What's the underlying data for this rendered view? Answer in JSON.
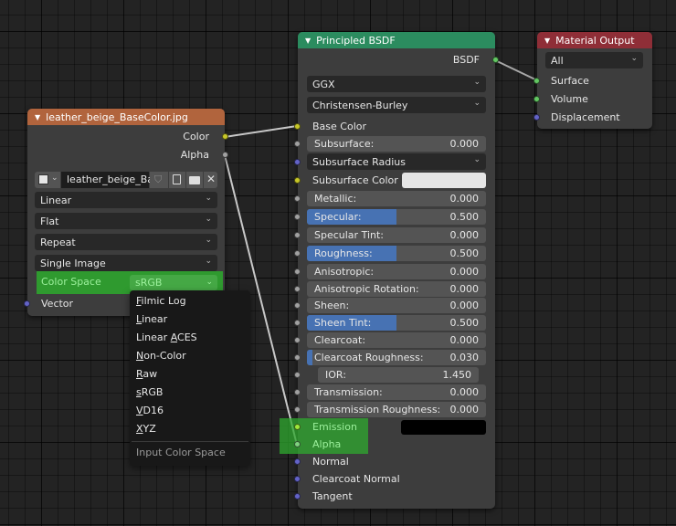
{
  "colors": {
    "image_node_header": "#b1643d",
    "bsdf_node_header": "#2b8c5f",
    "output_node_header": "#8f2e37",
    "highlight_green": "#2f9a2f",
    "slider_fill": "#4772b3"
  },
  "image_node": {
    "title": "leather_beige_BaseColor.jpg",
    "outputs": [
      "Color",
      "Alpha"
    ],
    "image_name": "leather_beige_Ba..",
    "icons": [
      "image-browse-icon",
      "fake-user-shield-icon",
      "duplicate-icon",
      "open-folder-icon",
      "unlink-x-icon"
    ],
    "interpolation": "Linear",
    "projection": "Flat",
    "extension": "Repeat",
    "source": "Single Image",
    "color_space_label": "Color Space",
    "color_space_value": "sRGB",
    "input_vector": "Vector"
  },
  "color_space_menu": {
    "items": [
      {
        "pre": "",
        "ul": "F",
        "post": "ilmic Log"
      },
      {
        "pre": "",
        "ul": "L",
        "post": "inear"
      },
      {
        "pre": "Linear ",
        "ul": "A",
        "post": "CES"
      },
      {
        "pre": "",
        "ul": "N",
        "post": "on-Color"
      },
      {
        "pre": "",
        "ul": "R",
        "post": "aw"
      },
      {
        "pre": "",
        "ul": "s",
        "post": "RGB"
      },
      {
        "pre": "",
        "ul": "V",
        "post": "D16"
      },
      {
        "pre": "",
        "ul": "X",
        "post": "YZ"
      }
    ],
    "title": "Input Color Space"
  },
  "bsdf_node": {
    "title": "Principled BSDF",
    "output": "BSDF",
    "distribution": "GGX",
    "subsurface_method": "Christensen-Burley",
    "base_color_label": "Base Color",
    "subsurface_radius_label": "Subsurface Radius",
    "subsurface_color_label": "Subsurface Color",
    "subsurface_color": "#e6e6e6",
    "emission_label": "Emission",
    "emission_color": "#000000",
    "alpha_label": "Alpha",
    "normal_label": "Normal",
    "clearcoat_normal_label": "Clearcoat Normal",
    "tangent_label": "Tangent",
    "sliders": {
      "subsurface": {
        "label": "Subsurface:",
        "value": "0.000",
        "fill": 0.0
      },
      "metallic": {
        "label": "Metallic:",
        "value": "0.000",
        "fill": 0.0
      },
      "specular": {
        "label": "Specular:",
        "value": "0.500",
        "fill": 0.5
      },
      "specular_tint": {
        "label": "Specular Tint:",
        "value": "0.000",
        "fill": 0.0
      },
      "roughness": {
        "label": "Roughness:",
        "value": "0.500",
        "fill": 0.5
      },
      "anisotropic": {
        "label": "Anisotropic:",
        "value": "0.000",
        "fill": 0.0
      },
      "anisotropic_rotation": {
        "label": "Anisotropic Rotation:",
        "value": "0.000",
        "fill": 0.0
      },
      "sheen": {
        "label": "Sheen:",
        "value": "0.000",
        "fill": 0.0
      },
      "sheen_tint": {
        "label": "Sheen Tint:",
        "value": "0.500",
        "fill": 0.5
      },
      "clearcoat": {
        "label": "Clearcoat:",
        "value": "0.000",
        "fill": 0.0
      },
      "clearcoat_roughness": {
        "label": "Clearcoat Roughness:",
        "value": "0.030",
        "fill": 0.03
      },
      "ior": {
        "label": "IOR:",
        "value": "1.450",
        "fill": 0.0
      },
      "transmission": {
        "label": "Transmission:",
        "value": "0.000",
        "fill": 0.0
      },
      "transmission_roughness": {
        "label": "Transmission Roughness:",
        "value": "0.000",
        "fill": 0.0
      }
    }
  },
  "output_node": {
    "title": "Material Output",
    "target": "All",
    "inputs": [
      "Surface",
      "Volume",
      "Displacement"
    ]
  }
}
